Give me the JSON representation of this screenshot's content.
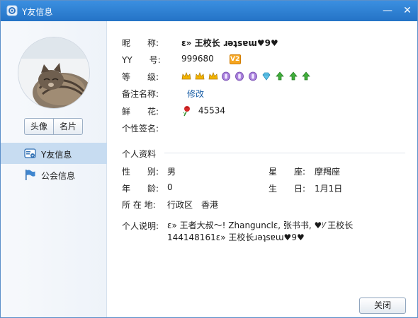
{
  "window": {
    "title": "Y友信息",
    "minimize_glyph": "—",
    "close_glyph": "✕"
  },
  "sidebar": {
    "avatar_tab": "头像",
    "card_tab": "名片",
    "nav": [
      {
        "label": "Y友信息",
        "icon": "contact-card-icon",
        "active": true
      },
      {
        "label": "公会信息",
        "icon": "flag-icon",
        "active": false
      }
    ]
  },
  "profile": {
    "nickname_label": "昵　　称:",
    "nickname_value": "ε» 王校长 ɹǝʇsɐɯ♥9♥",
    "yy_label": "YY　　号:",
    "yy_value": "999680",
    "vip_badge": "V2",
    "level_label": "等　　级:",
    "level_icons": [
      "crown-icon",
      "crown-icon",
      "crown-icon",
      "moon-icon",
      "moon-icon",
      "moon-icon",
      "diamond-icon",
      "leaf-icon",
      "leaf-icon",
      "leaf-icon"
    ],
    "remark_label": "备注名称:",
    "remark_action": "修改",
    "flower_label": "鲜　　花:",
    "flower_value": "45534",
    "signature_label": "个性签名:",
    "signature_value": ""
  },
  "personal": {
    "section_title": "个人资料",
    "gender_label": "性　　别:",
    "gender_value": "男",
    "age_label": "年　　龄:",
    "age_value": "0",
    "location_label": "所 在 地:",
    "location_value": "行政区　香港",
    "constellation_label": "星　　座:",
    "constellation_value": "摩羯座",
    "birthday_label": "生　　日:",
    "birthday_value": "1月1日",
    "description_label": "个人说明:",
    "description_line1": "ε» 王者大叔～! Zhangunclε, 张书书, ♥ⁱ⁄ 王校长",
    "description_line2": "144148161ε» 王校长ɹǝʇsɐɯ♥9♥"
  },
  "footer": {
    "close_label": "关闭"
  },
  "colors": {
    "titlebar": "#2f82d6",
    "link": "#1b5fa6",
    "nav_active": "#c7dcf1"
  }
}
